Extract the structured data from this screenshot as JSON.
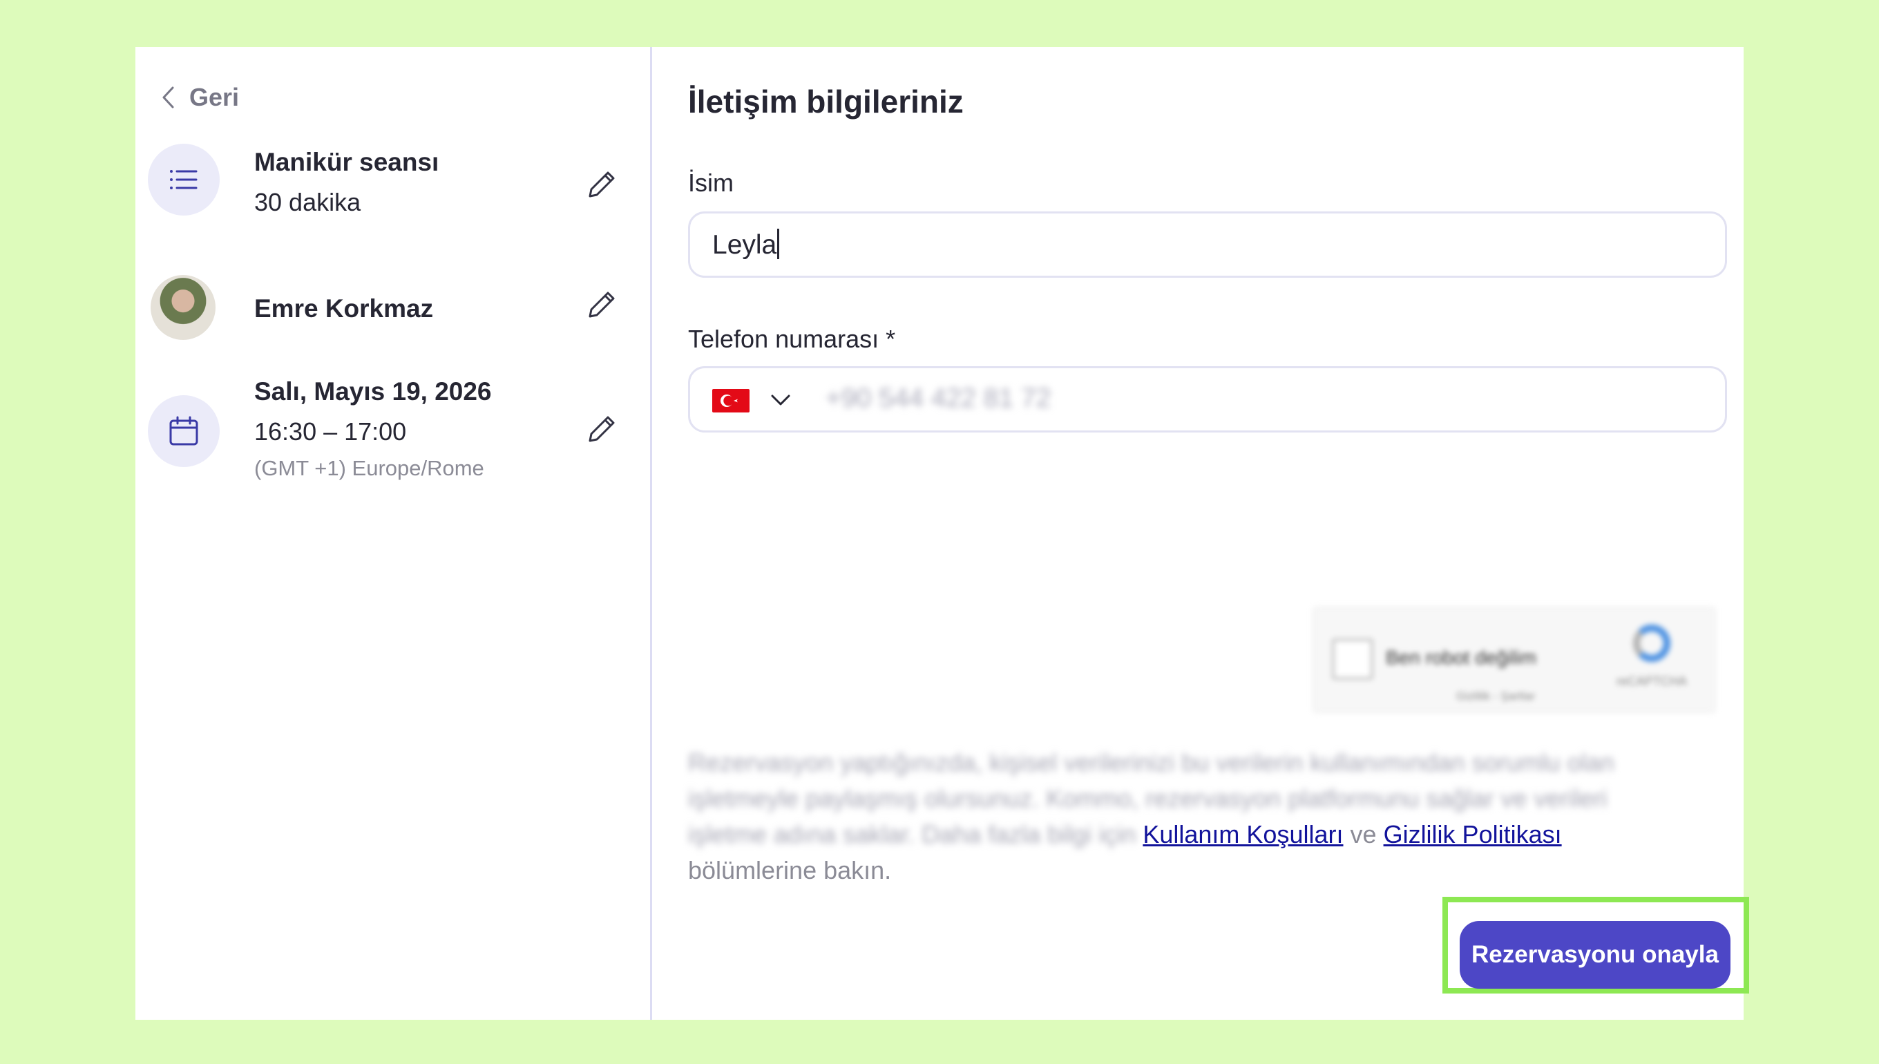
{
  "back": {
    "label": "Geri"
  },
  "summary": {
    "service": {
      "title": "Manikür seansı",
      "duration": "30 dakika",
      "icon": "list-icon"
    },
    "staff": {
      "name": "Emre Korkmaz"
    },
    "appointment": {
      "date": "Salı, Mayıs 19, 2026",
      "time": "16:30 – 17:00",
      "timezone": "(GMT +1) Europe/Rome",
      "icon": "calendar-icon"
    }
  },
  "form": {
    "heading": "İletişim bilgileriniz",
    "name_label": "İsim",
    "name_value": "Leyla",
    "phone_label": "Telefon numarası *",
    "phone_country": "TR",
    "phone_value": "+90 544 422 81 72"
  },
  "recaptcha": {
    "label": "Ben robot değilim",
    "brand": "reCAPTCHA",
    "terms": "Gizlilik - Şartlar"
  },
  "disclaimer": {
    "blurred_text": "Rezervasyon yaptığınızda, kişisel verilerinizi bu verilerin kullanımından sorumlu olan işletmeyle paylaşmış olursunuz. Kommo, rezervasyon platformunu sağlar ve verileri işletme adına saklar. Daha fazla bilgi için",
    "terms_link": "Kullanım Koşulları",
    "connector": "ve",
    "privacy_link": "Gizlilik Politikası",
    "suffix": "bölümlerine bakın."
  },
  "confirm_button": "Rezervasyonu onayla",
  "colors": {
    "background": "#ddfbbb",
    "primary": "#4d47c6",
    "highlight": "#8de853",
    "link": "#12139b"
  }
}
